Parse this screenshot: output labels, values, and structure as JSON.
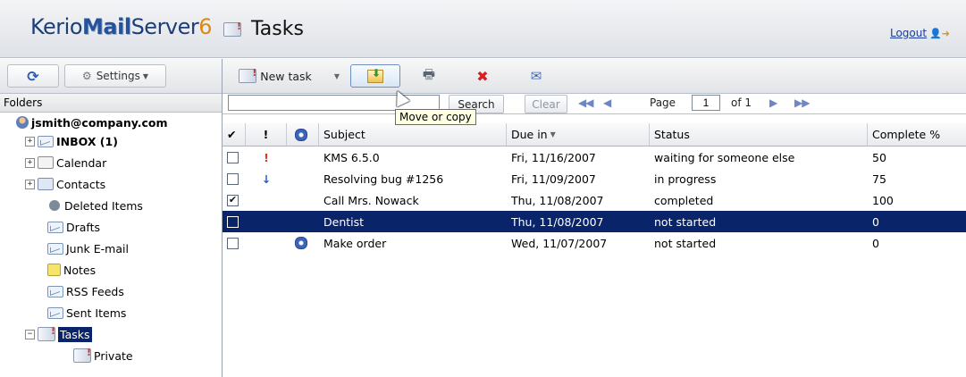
{
  "header": {
    "brand_part1": "Kerio",
    "brand_part2": "Mail",
    "brand_part3": "Server",
    "brand_version": "6",
    "page_title": "Tasks",
    "logout_label": "Logout"
  },
  "sidebar": {
    "settings_label": "Settings",
    "folders_heading": "Folders",
    "account": "jsmith@company.com",
    "folders": [
      {
        "label": "INBOX (1)",
        "icon": "inbox-icon"
      },
      {
        "label": "Calendar",
        "icon": "calendar-icon"
      },
      {
        "label": "Contacts",
        "icon": "contacts-icon"
      },
      {
        "label": "Deleted Items",
        "icon": "trash-icon"
      },
      {
        "label": "Drafts",
        "icon": "mail-folder-icon"
      },
      {
        "label": "Junk E-mail",
        "icon": "mail-folder-icon"
      },
      {
        "label": "Notes",
        "icon": "notes-icon"
      },
      {
        "label": "RSS Feeds",
        "icon": "mail-folder-icon"
      },
      {
        "label": "Sent Items",
        "icon": "mail-folder-icon"
      },
      {
        "label": "Tasks",
        "icon": "tasks-icon"
      },
      {
        "label": "Private",
        "icon": "tasks-icon"
      }
    ]
  },
  "toolbar": {
    "new_task_label": "New task",
    "tooltip": "Move or copy"
  },
  "search": {
    "value": "",
    "search_label": "Search",
    "clear_label": "Clear",
    "page_label": "Page",
    "page_value": "1",
    "of_label": "of 1"
  },
  "grid": {
    "columns": {
      "check": "✔",
      "priority": "!",
      "subject": "Subject",
      "due": "Due in",
      "status": "Status",
      "complete": "Complete %"
    },
    "rows": [
      {
        "checked": "",
        "priority": "!",
        "subject": "KMS 6.5.0",
        "due": "Fri, 11/16/2007",
        "status": "waiting for someone else",
        "complete": "50"
      },
      {
        "checked": "",
        "priority": "↓",
        "subject": "Resolving bug #1256",
        "due": "Fri, 11/09/2007",
        "status": "in progress",
        "complete": "75"
      },
      {
        "checked": "✔",
        "priority": "",
        "subject": "Call Mrs. Nowack",
        "due": "Thu, 11/08/2007",
        "status": "completed",
        "complete": "100"
      },
      {
        "checked": "",
        "priority": "",
        "subject": "Dentist",
        "due": "Thu, 11/08/2007",
        "status": "not started",
        "complete": "0"
      },
      {
        "checked": "",
        "priority": "",
        "subject": "Make order",
        "due": "Wed, 11/07/2007",
        "status": "not started",
        "complete": "0"
      }
    ]
  },
  "colors": {
    "selection": "#0a246a",
    "brand": "#1c3f78",
    "version_accent": "#d98a16",
    "priority_high": "#e0342a",
    "priority_low": "#2c57c7"
  }
}
